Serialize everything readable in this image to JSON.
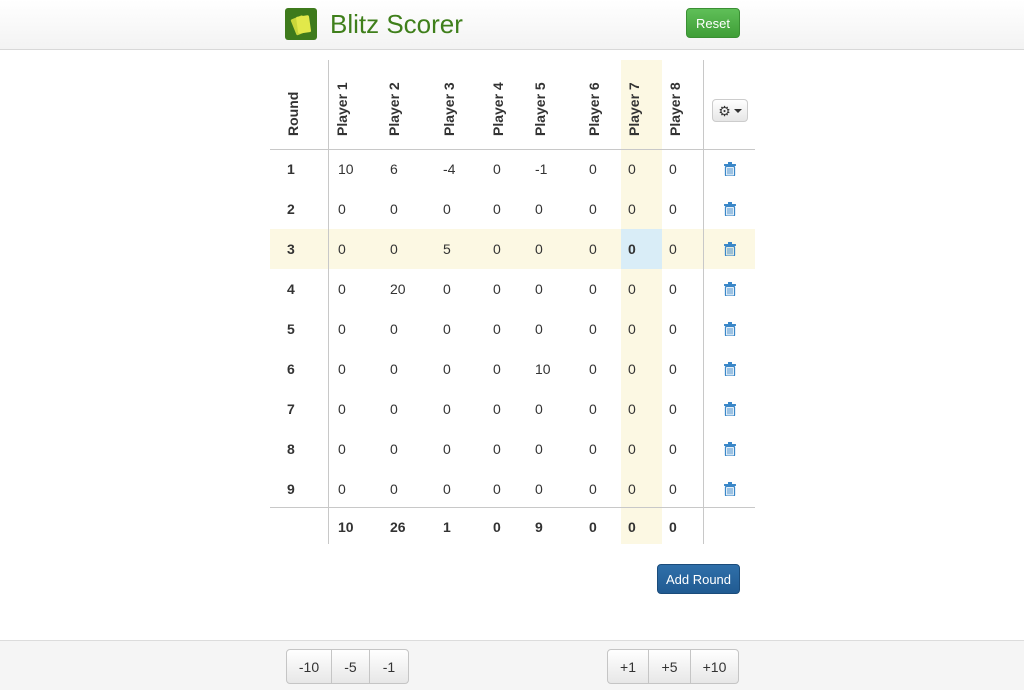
{
  "app": {
    "title": "Blitz Scorer",
    "reset_label": "Reset"
  },
  "table": {
    "round_header": "Round",
    "players": [
      "Player 1",
      "Player 2",
      "Player 3",
      "Player 4",
      "Player 5",
      "Player 6",
      "Player 7",
      "Player 8"
    ],
    "rows": [
      {
        "round": "1",
        "scores": [
          "10",
          "6",
          "-4",
          "0",
          "-1",
          "0",
          "0",
          "0"
        ]
      },
      {
        "round": "2",
        "scores": [
          "0",
          "0",
          "0",
          "0",
          "0",
          "0",
          "0",
          "0"
        ]
      },
      {
        "round": "3",
        "scores": [
          "0",
          "0",
          "5",
          "0",
          "0",
          "0",
          "0",
          "0"
        ]
      },
      {
        "round": "4",
        "scores": [
          "0",
          "20",
          "0",
          "0",
          "0",
          "0",
          "0",
          "0"
        ]
      },
      {
        "round": "5",
        "scores": [
          "0",
          "0",
          "0",
          "0",
          "0",
          "0",
          "0",
          "0"
        ]
      },
      {
        "round": "6",
        "scores": [
          "0",
          "0",
          "0",
          "0",
          "10",
          "0",
          "0",
          "0"
        ]
      },
      {
        "round": "7",
        "scores": [
          "0",
          "0",
          "0",
          "0",
          "0",
          "0",
          "0",
          "0"
        ]
      },
      {
        "round": "8",
        "scores": [
          "0",
          "0",
          "0",
          "0",
          "0",
          "0",
          "0",
          "0"
        ]
      },
      {
        "round": "9",
        "scores": [
          "0",
          "0",
          "0",
          "0",
          "0",
          "0",
          "0",
          "0"
        ]
      }
    ],
    "totals": [
      "10",
      "26",
      "1",
      "0",
      "9",
      "0",
      "0",
      "0"
    ],
    "highlight_color": "#fcf8e3",
    "active_cell_color": "#d9edf7"
  },
  "actions": {
    "add_round_label": "Add Round"
  },
  "footer": {
    "minus_buttons": [
      "-10",
      "-5",
      "-1"
    ],
    "plus_buttons": [
      "+1",
      "+5",
      "+10"
    ]
  },
  "colors": {
    "brand": "#3f7f1b",
    "success": "#46a83f",
    "primary": "#2a659e",
    "trash": "#3a87c8"
  }
}
